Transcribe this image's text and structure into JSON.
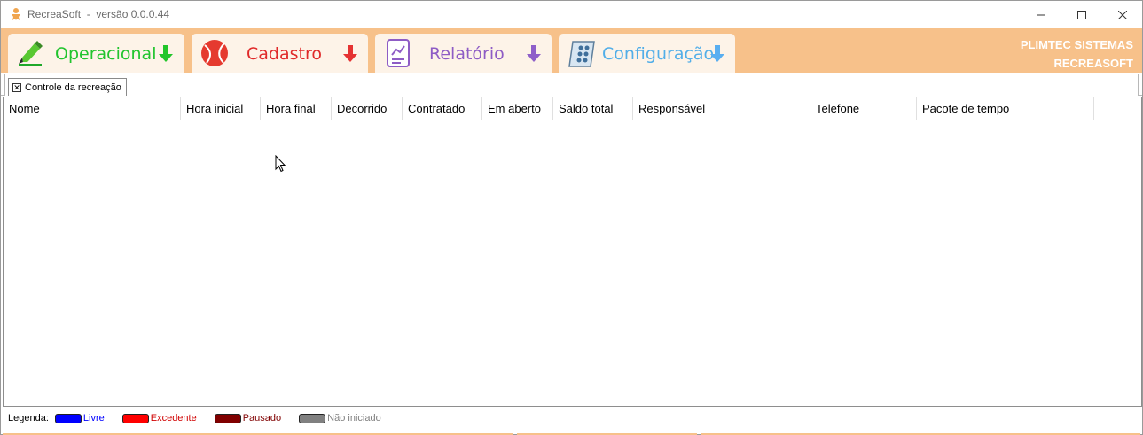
{
  "window": {
    "title": "RecreaSoft  -  versão 0.0.0.44"
  },
  "ribbon": {
    "tabs": [
      {
        "label": "Operacional",
        "color": "#21c42e",
        "icon": "highlighter-icon",
        "arrow_color": "#22c52a"
      },
      {
        "label": "Cadastro",
        "color": "#e02a2a",
        "icon": "ball-icon",
        "arrow_color": "#e53232"
      },
      {
        "label": "Relatório",
        "color": "#8e5cc5",
        "icon": "report-chart-icon",
        "arrow_color": "#8f5fc9"
      },
      {
        "label": "Configuração",
        "color": "#52aee8",
        "icon": "settings-panel-icon",
        "arrow_color": "#59aef0"
      }
    ],
    "brand_line1": "PLIMTEC SISTEMAS",
    "brand_line2": "RECREASOFT",
    "background": "#f7c18a"
  },
  "doc_tab": {
    "label": "Controle da recreação"
  },
  "grid": {
    "columns": [
      "Nome",
      "Hora inicial",
      "Hora final",
      "Decorrido",
      "Contratado",
      "Em aberto",
      "Saldo total",
      "Responsável",
      "Telefone",
      "Pacote de tempo"
    ],
    "rows": []
  },
  "legend": {
    "label": "Legenda:",
    "items": [
      {
        "label": "Livre",
        "color": "#0000ff",
        "text_color": "#0000ff"
      },
      {
        "label": "Excedente",
        "color": "#ff0000",
        "text_color": "#d00000"
      },
      {
        "label": "Pausado",
        "color": "#800000",
        "text_color": "#800000"
      },
      {
        "label": "Não iniciado",
        "color": "#808080",
        "text_color": "#808080"
      }
    ]
  }
}
